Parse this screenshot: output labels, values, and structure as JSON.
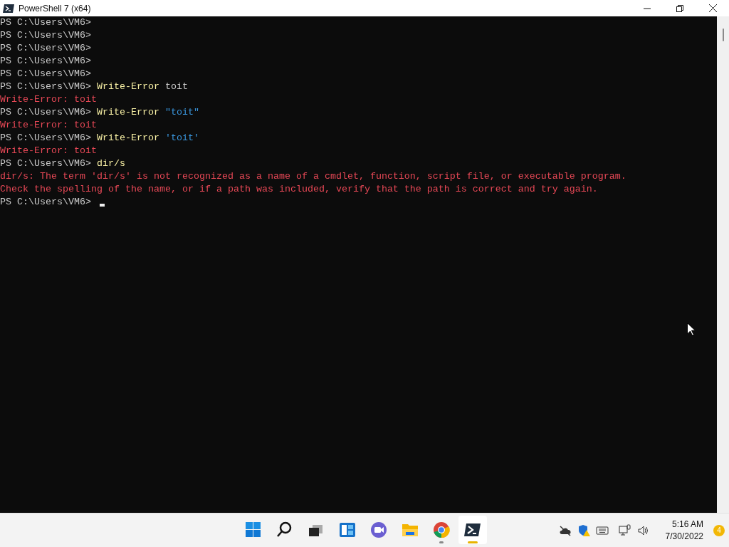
{
  "window": {
    "title": "PowerShell 7 (x64)"
  },
  "terminal": {
    "lines": [
      {
        "segments": [
          {
            "kind": "prompt",
            "text": "PS C:\\Users\\VM6>"
          }
        ]
      },
      {
        "segments": [
          {
            "kind": "prompt",
            "text": "PS C:\\Users\\VM6>"
          }
        ]
      },
      {
        "segments": [
          {
            "kind": "prompt",
            "text": "PS C:\\Users\\VM6>"
          }
        ]
      },
      {
        "segments": [
          {
            "kind": "prompt",
            "text": "PS C:\\Users\\VM6>"
          }
        ]
      },
      {
        "segments": [
          {
            "kind": "prompt",
            "text": "PS C:\\Users\\VM6>"
          }
        ]
      },
      {
        "segments": [
          {
            "kind": "prompt",
            "text": "PS C:\\Users\\VM6>"
          },
          {
            "kind": "command",
            "text": "Write-Error"
          },
          {
            "kind": "argument",
            "text": "toit"
          }
        ]
      },
      {
        "segments": [
          {
            "kind": "error",
            "text": "Write-Error: toit"
          }
        ]
      },
      {
        "segments": [
          {
            "kind": "prompt",
            "text": "PS C:\\Users\\VM6>"
          },
          {
            "kind": "command",
            "text": "Write-Error"
          },
          {
            "kind": "string",
            "text": "\"toit\""
          }
        ]
      },
      {
        "segments": [
          {
            "kind": "error",
            "text": "Write-Error: toit"
          }
        ]
      },
      {
        "segments": [
          {
            "kind": "prompt",
            "text": "PS C:\\Users\\VM6>"
          },
          {
            "kind": "command",
            "text": "Write-Error"
          },
          {
            "kind": "string",
            "text": "'toit'"
          }
        ]
      },
      {
        "segments": [
          {
            "kind": "error",
            "text": "Write-Error: toit"
          }
        ]
      },
      {
        "segments": [
          {
            "kind": "prompt",
            "text": "PS C:\\Users\\VM6>"
          },
          {
            "kind": "command",
            "text": "dir/s"
          }
        ]
      },
      {
        "segments": [
          {
            "kind": "error",
            "text": "dir/s: The term 'dir/s' is not recognized as a name of a cmdlet, function, script file, or executable program."
          }
        ]
      },
      {
        "segments": [
          {
            "kind": "error",
            "text": "Check the spelling of the name, or if a path was included, verify that the path is correct and try again."
          }
        ]
      },
      {
        "segments": [
          {
            "kind": "prompt",
            "text": "PS C:\\Users\\VM6>"
          }
        ],
        "cursor": true
      }
    ]
  },
  "taskbar": {
    "apps": [
      {
        "kind": "start",
        "running": false,
        "selected": false
      },
      {
        "kind": "search",
        "running": false,
        "selected": false
      },
      {
        "kind": "taskview",
        "running": false,
        "selected": false
      },
      {
        "kind": "widgets",
        "running": false,
        "selected": false
      },
      {
        "kind": "chat",
        "running": false,
        "selected": false
      },
      {
        "kind": "explorer",
        "running": false,
        "selected": false
      },
      {
        "kind": "browser",
        "running": true,
        "selected": false
      },
      {
        "kind": "terminal",
        "running": true,
        "selected": true
      }
    ],
    "time": "5:16 AM",
    "date": "7/30/2022",
    "notifications": "4"
  }
}
